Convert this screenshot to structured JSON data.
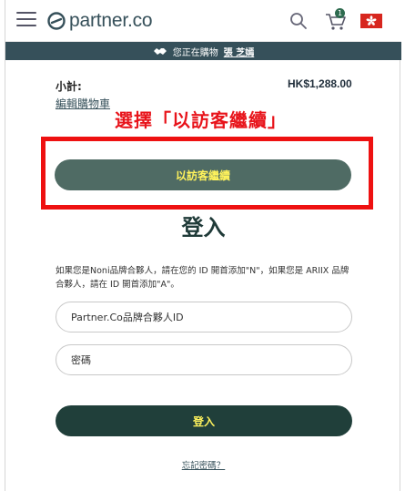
{
  "header": {
    "logo_text": "partner.co",
    "cart_count": "1",
    "icons": [
      "menu-icon",
      "search-icon",
      "cart-icon",
      "hk-flag-icon"
    ]
  },
  "banner": {
    "text": "您正在購物",
    "shopper_name": "張 芝嫣"
  },
  "cart": {
    "subtotal_label": "小計:",
    "subtotal_value": "HK$1,288.00",
    "edit_link": "編輯購物車"
  },
  "annotation": {
    "text": "選擇「以訪客繼續」"
  },
  "guest_button": {
    "label": "以訪客繼續"
  },
  "login": {
    "title": "登入",
    "notice": "如果您是Noni品牌合夥人，請在您的 ID 開首添加\"N\"，如果您是 ARIIX 品牌合夥人，請在 ID 開首添加\"A\"。",
    "id_placeholder": "Partner.Co品牌合夥人ID",
    "password_placeholder": "密碼",
    "submit_label": "登入",
    "forgot_link": "忘記密碼？"
  },
  "colors": {
    "brand_dark": "#203f3a",
    "brand_mid": "#4f6b64",
    "button_text": "#fff35c",
    "banner_bg": "#36505a",
    "annotation_red": "#e8141b"
  }
}
